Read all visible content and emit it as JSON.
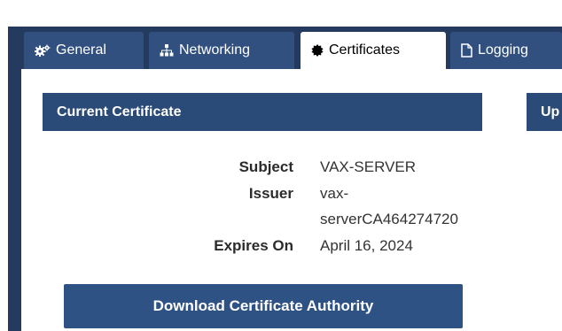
{
  "tabs": [
    {
      "label": "General",
      "icon": "cogs-icon"
    },
    {
      "label": "Networking",
      "icon": "sitemap-icon"
    },
    {
      "label": "Certificates",
      "icon": "certificate-icon"
    },
    {
      "label": "Logging",
      "icon": "file-icon"
    }
  ],
  "active_tab": "Certificates",
  "current_certificate": {
    "title": "Current Certificate",
    "subject_label": "Subject",
    "subject_value": "VAX-SERVER",
    "issuer_label": "Issuer",
    "issuer_value_line1": "vax-",
    "issuer_value_line2": "serverCA464274720",
    "expires_label": "Expires On",
    "expires_value": "April 16, 2024",
    "download_label": "Download Certificate Authority"
  },
  "second_panel": {
    "title": "Up"
  },
  "colors": {
    "frame": "#243a5e",
    "tab_inactive": "#31507f",
    "panel_header": "#2a4a78",
    "button": "#2e5283"
  }
}
